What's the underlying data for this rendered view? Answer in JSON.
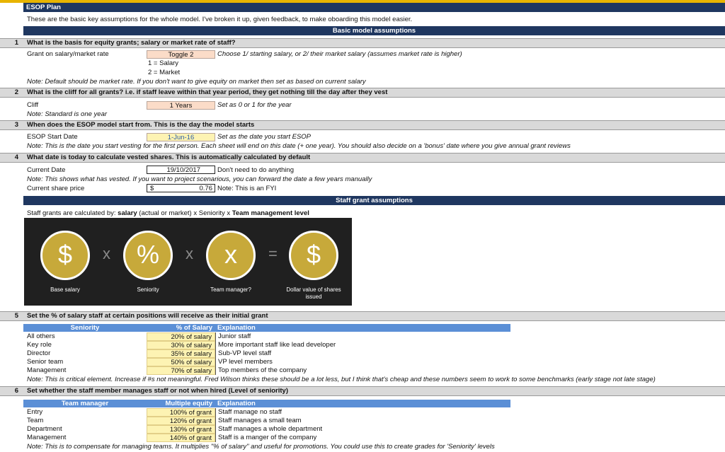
{
  "header": {
    "title": "ESOP Plan",
    "intro": "These are the basic key assumptions for the whole model. I've broken it up, given feedback, to make oboarding this model easier."
  },
  "section_basic": "Basic model assumptions",
  "q1": {
    "num": "1",
    "text": "What is the basis for equity grants; salary or market rate of staff?",
    "label": "Grant on salary/market rate",
    "value": "Toggle  2",
    "hint": "Choose 1/ starting salary, or 2/ their market salary (assumes market rate is higher)",
    "opt1": "1 = Salary",
    "opt2": "2 = Market",
    "note": "Note: Default should be market rate. If you don't want to give equity on market then set as based on current salary"
  },
  "q2": {
    "num": "2",
    "text": "What is the cliff for all grants? i.e. if staff leave within that year period, they get nothing till the day after they vest",
    "label": "Cliff",
    "value": "1 Years",
    "hint": "Set as 0 or 1 for the year",
    "note": "Note: Standard is one year"
  },
  "q3": {
    "num": "3",
    "text": "When does the ESOP model start from. This is the day the model starts",
    "label": "ESOP Start Date",
    "value": "1-Jun-16",
    "hint": "Set as the date you start ESOP",
    "note": "Note: This is the date you start vesting for the first person. Each sheet will end on this date (+ one year). You should also decide on a 'bonus' date where you give annual grant reviews"
  },
  "q4": {
    "num": "4",
    "text": "What date is today to calculate vested shares. This is automatically calculated by default",
    "label": "Current Date",
    "value": "19/10/2017",
    "hint": "Don't need to do anything",
    "note": "Note: This shows what has vested. If you want to project scenarious, you can forward the date a few years manually",
    "price_label": "Current share price",
    "price_currency": "$",
    "price_value": "0.76",
    "price_note": "Note: This is an FYI"
  },
  "section_staff": "Staff grant assumptions",
  "formula": {
    "prefix": "Staff grants are calculated by: ",
    "salary": "salary",
    "mid": " (actual or market) x Seniority x ",
    "team": "Team management level"
  },
  "diagram": {
    "symbols": [
      "$",
      "%",
      "x",
      "$"
    ],
    "ops": [
      "x",
      "x",
      "="
    ],
    "labels": [
      "Base salary",
      "Seniority",
      "Team manager?",
      "Dollar value of shares issued"
    ]
  },
  "q5": {
    "num": "5",
    "text": "Set the % of salary staff at certain positions will receive as their initial grant",
    "headers": [
      "Seniority",
      "% of Salary",
      "Explanation"
    ],
    "rows": [
      {
        "name": "All others",
        "pct": "20% of salary",
        "exp": "Junior staff"
      },
      {
        "name": "Key role",
        "pct": "30% of salary",
        "exp": "More important staff like lead developer"
      },
      {
        "name": "Director",
        "pct": "35% of salary",
        "exp": "Sub-VP level staff"
      },
      {
        "name": "Senior team",
        "pct": "50% of salary",
        "exp": "VP level members"
      },
      {
        "name": "Management",
        "pct": "70% of salary",
        "exp": "Top members of the company"
      }
    ],
    "note": "Note: This is critical element. Increase if #s not meaningful. Fred Wilson thinks these should be a lot less, but I think that's cheap and these numbers seem to work to some benchmarks (early stage not late stage)"
  },
  "q6": {
    "num": "6",
    "text": "Set whether the staff member manages staff or not when hired (Level of seniority)",
    "headers": [
      "Team manager",
      "Multiple equity",
      "Explanation"
    ],
    "rows": [
      {
        "name": "Entry",
        "pct": "100% of grant",
        "exp": "Staff manage no staff"
      },
      {
        "name": "Team",
        "pct": "120% of grant",
        "exp": "Staff manages a small team"
      },
      {
        "name": "Department",
        "pct": "130% of grant",
        "exp": "Staff manages a whole department"
      },
      {
        "name": "Management",
        "pct": "140% of grant",
        "exp": "Staff is a manger of the company"
      }
    ],
    "note": "Note: This is to compensate for managing teams. It multiplies \"% of salary\" and useful for promotions. You could use this to create grades for 'Seniority' levels"
  }
}
